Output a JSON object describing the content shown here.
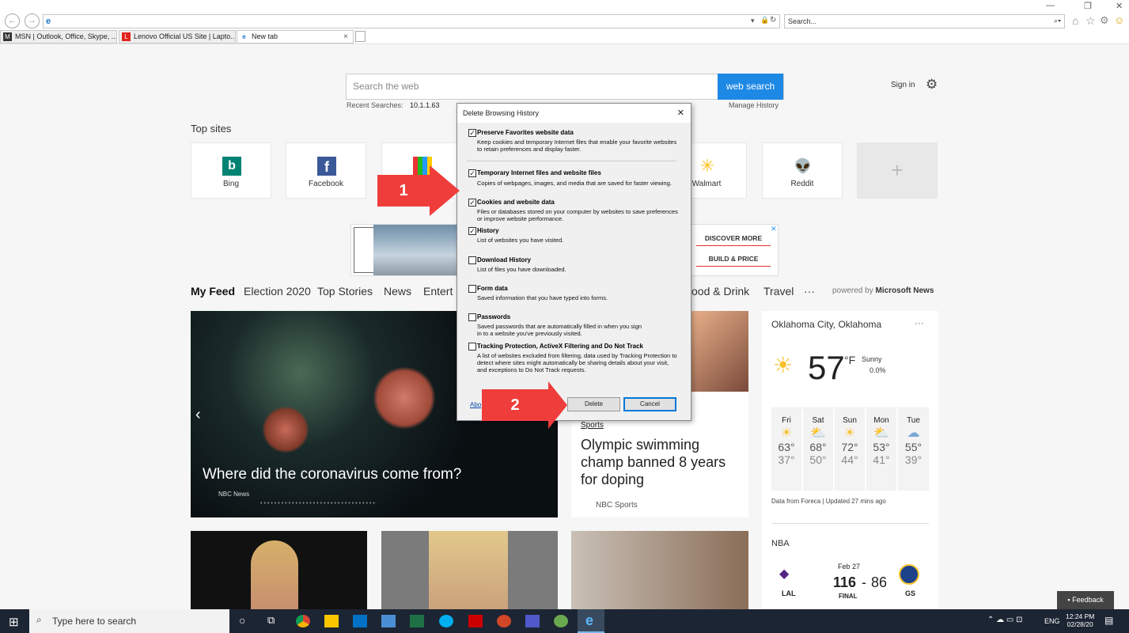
{
  "browser": {
    "search_placeholder": "Search...",
    "tabs": [
      {
        "label": "MSN | Outlook, Office, Skype, ..."
      },
      {
        "label": "Lenovo Official US Site | Lapto..."
      },
      {
        "label": "New tab"
      }
    ],
    "close_tab": "×"
  },
  "page": {
    "search_placeholder": "Search the web",
    "search_button": "web search",
    "recent_label": "Recent Searches:",
    "recent_value": "10.1.1.63",
    "manage_history": "Manage History",
    "sign_in": "Sign in",
    "top_sites_label": "Top sites",
    "top_sites": [
      {
        "label": "Bing"
      },
      {
        "label": "Facebook"
      },
      {
        "label": ""
      },
      {
        "label": ""
      },
      {
        "label": "Walmart"
      },
      {
        "label": "Reddit"
      }
    ],
    "ad": {
      "btn1": "DISCOVER MORE",
      "btn2": "BUILD & PRICE"
    },
    "feed_tabs": [
      "My Feed",
      "Election 2020",
      "Top Stories",
      "News",
      "Entert",
      "ood & Drink",
      "Travel",
      "···"
    ],
    "powered_by": "powered by",
    "powered_brand": "Microsoft News",
    "hero": {
      "headline": "Where did the coronavirus come from?",
      "source": "NBC News"
    },
    "story": {
      "category": "Sports",
      "headline": "Olympic swimming champ banned 8 years for doping",
      "source": "NBC Sports"
    },
    "weather": {
      "location": "Oklahoma City, Oklahoma",
      "temp": "57",
      "unit": "°F",
      "condition": "Sunny",
      "precip": "0.0%",
      "days": [
        {
          "d": "Fri",
          "hi": "63°",
          "lo": "37°"
        },
        {
          "d": "Sat",
          "hi": "68°",
          "lo": "50°"
        },
        {
          "d": "Sun",
          "hi": "72°",
          "lo": "44°"
        },
        {
          "d": "Mon",
          "hi": "53°",
          "lo": "41°"
        },
        {
          "d": "Tue",
          "hi": "55°",
          "lo": "39°"
        }
      ],
      "footer": "Data from Foreca | Updated 27 mins ago"
    },
    "nba": {
      "label": "NBA",
      "date": "Feb 27",
      "home": "LAL",
      "away": "GS",
      "score_home": "116",
      "score_sep": "-",
      "score_away": "86",
      "status": "FINAL"
    },
    "feedback": "Feedback"
  },
  "dialog": {
    "title": "Delete Browsing History",
    "close": "✕",
    "options": [
      {
        "label": "Preserve Favorites website data",
        "desc": "Keep cookies and temporary Internet files that enable your favorite websites to retain preferences and display faster.",
        "checked": true
      },
      {
        "label": "Temporary Internet files and website files",
        "desc": "Copies of webpages, images, and media that are saved for faster viewing.",
        "checked": true
      },
      {
        "label": "Cookies and website data",
        "desc": "Files or databases stored on your computer by websites to save preferences or improve website performance.",
        "checked": true
      },
      {
        "label": "History",
        "desc": "List of websites you have visited.",
        "checked": true
      },
      {
        "label": "Download History",
        "desc": "List of files you have downloaded.",
        "checked": false
      },
      {
        "label": "Form data",
        "desc": "Saved information that you have typed into forms.",
        "checked": false
      },
      {
        "label": "Passwords",
        "desc": "Saved passwords that are automatically filled in when you sign in to a website you've previously visited.",
        "checked": false
      },
      {
        "label": "Tracking Protection, ActiveX Filtering and Do Not Track",
        "desc": "A list of websites excluded from filtering, data used by Tracking Protection to detect where sites might automatically be sharing details about your visit, and exceptions to Do Not Track requests.",
        "checked": false
      }
    ],
    "about_link": "Abo",
    "delete": "Delete",
    "cancel": "Cancel"
  },
  "annotations": {
    "step1": "1",
    "step2": "2"
  },
  "taskbar": {
    "search": "Type here to search",
    "lang": "ENG",
    "time": "12:24 PM",
    "date": "02/28/20"
  }
}
